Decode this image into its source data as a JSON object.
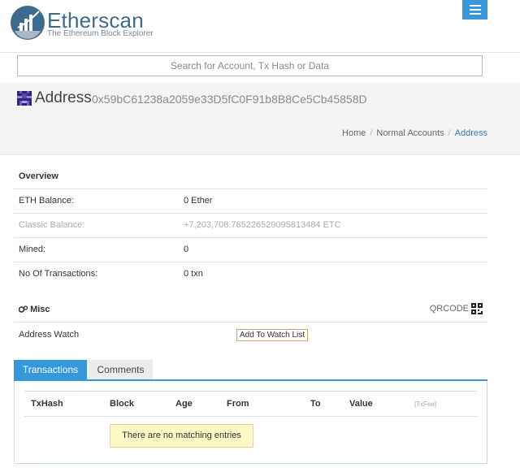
{
  "header": {
    "brand": "Etherscan",
    "tagline": "The Ethereum Block Explorer",
    "menu_icon": "hamburger-icon",
    "accent_color": "#3498db"
  },
  "search": {
    "placeholder": "Search for Account, Tx Hash or Data"
  },
  "page": {
    "title": "Address",
    "address": "0x59bC61238a2059e33D5fC0F91b8B8Ce5Cb45858D",
    "breadcrumb": [
      "Home",
      "Normal Accounts",
      "Address"
    ]
  },
  "overview": {
    "heading": "Overview",
    "rows": [
      {
        "label": "ETH Balance:",
        "value": "0 Ether"
      },
      {
        "label": "Classic Balance:",
        "value": "+7,203,708.765226529095813484 ETC"
      },
      {
        "label": "Mined:",
        "value": "0"
      },
      {
        "label": "No Of Transactions:",
        "value": "0 txn"
      }
    ]
  },
  "misc": {
    "heading": "Misc",
    "qrcode_label": "QRCODE",
    "watch_label": "Address Watch",
    "watch_button": "Add To Watch List"
  },
  "tabs": {
    "transactions": "Transactions",
    "comments": "Comments"
  },
  "table": {
    "columns": [
      "TxHash",
      "Block",
      "Age",
      "From",
      "To",
      "Value",
      "[TxFee]"
    ],
    "empty_message": "There are no matching entries"
  }
}
